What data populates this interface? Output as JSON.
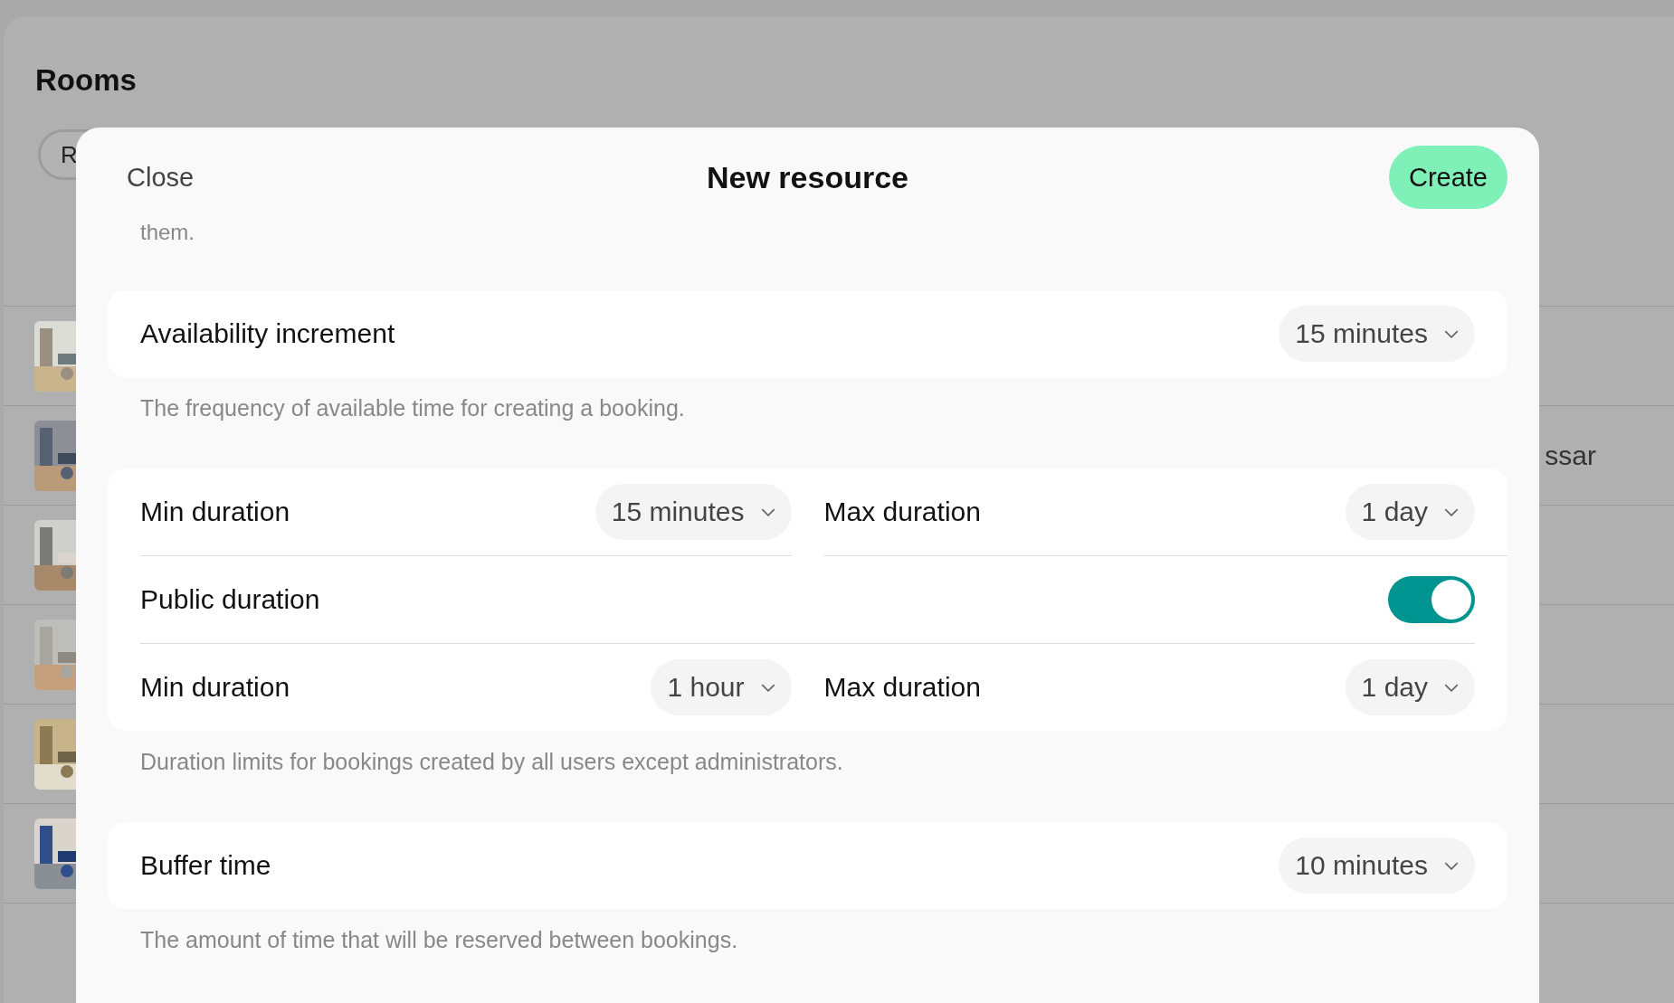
{
  "background": {
    "title": "Rooms",
    "chip": "R",
    "rows": [
      {
        "kind": "picture"
      },
      {
        "kind": "picture",
        "text": "ssar"
      },
      {
        "kind": "picture"
      },
      {
        "kind": "picture"
      },
      {
        "kind": "picture"
      },
      {
        "kind": "picture"
      }
    ]
  },
  "modal": {
    "close": "Close",
    "title": "New resource",
    "create": "Create",
    "intro": "them.",
    "sections": [
      {
        "rows": [
          {
            "kind": "single",
            "label": "Availability increment",
            "value": "15 minutes"
          }
        ],
        "description": "The frequency of available time for creating a booking."
      },
      {
        "rows": [
          {
            "kind": "pair",
            "left": {
              "label": "Min duration",
              "value": "15 minutes"
            },
            "right": {
              "label": "Max duration",
              "value": "1 day"
            }
          },
          {
            "kind": "toggle",
            "label": "Public duration",
            "on": true
          },
          {
            "kind": "pair",
            "left": {
              "label": "Min duration",
              "value": "1 hour"
            },
            "right": {
              "label": "Max duration",
              "value": "1 day"
            }
          }
        ],
        "description": "Duration limits for bookings created by all users except administrators."
      },
      {
        "rows": [
          {
            "kind": "single",
            "label": "Buffer time",
            "value": "10 minutes"
          }
        ],
        "description": "The amount of time that will be reserved between bookings."
      }
    ]
  }
}
